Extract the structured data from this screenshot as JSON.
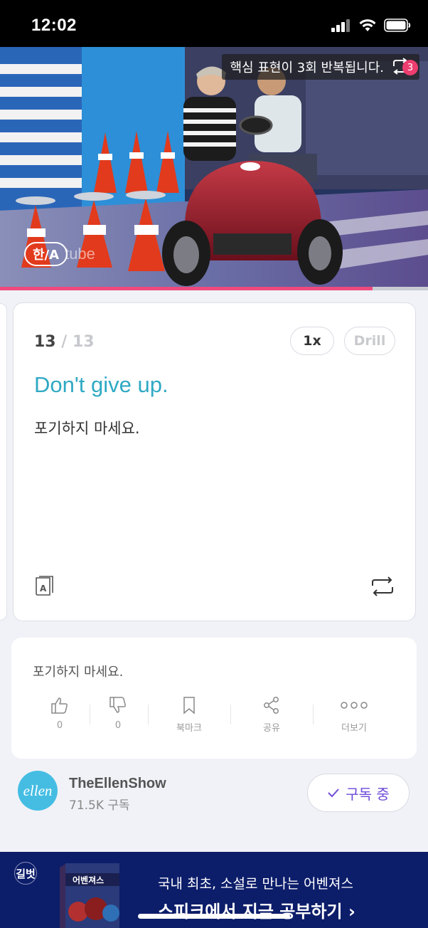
{
  "status_bar": {
    "time": "12:02"
  },
  "video": {
    "repeat_notice": "핵심 표현이 3회 반복됩니다.",
    "repeat_count": "3",
    "logo_text": "한/A",
    "logo_suffix": "tube",
    "progress_fraction": 0.87
  },
  "card": {
    "index": "13",
    "separator": " / ",
    "total": "13",
    "speed_label": "1x",
    "drill_label": "Drill",
    "english": "Don't give up.",
    "korean": "포기하지 마세요.",
    "dictionary_icon_letter": "A"
  },
  "info": {
    "text": "포기하지 마세요.",
    "like_count": "0",
    "dislike_count": "0",
    "bookmark_label": "북마크",
    "share_label": "공유",
    "more_label": "더보기"
  },
  "channel": {
    "avatar_text": "ellen",
    "name": "TheEllenShow",
    "subscribers": "71.5K 구독",
    "subscribe_label": "구독 중"
  },
  "ad": {
    "brand": "길벗",
    "book_title": "어벤져스",
    "line1": "국내 최초, 소설로 만나는 어벤져스",
    "line2": "스피크에서 지금 공부하기 ›"
  },
  "colors": {
    "accent_teal": "#2fa9c3",
    "accent_pink": "#ee4a7e",
    "accent_purple": "#6e4bd8",
    "ad_background": "#0c1d6a"
  }
}
